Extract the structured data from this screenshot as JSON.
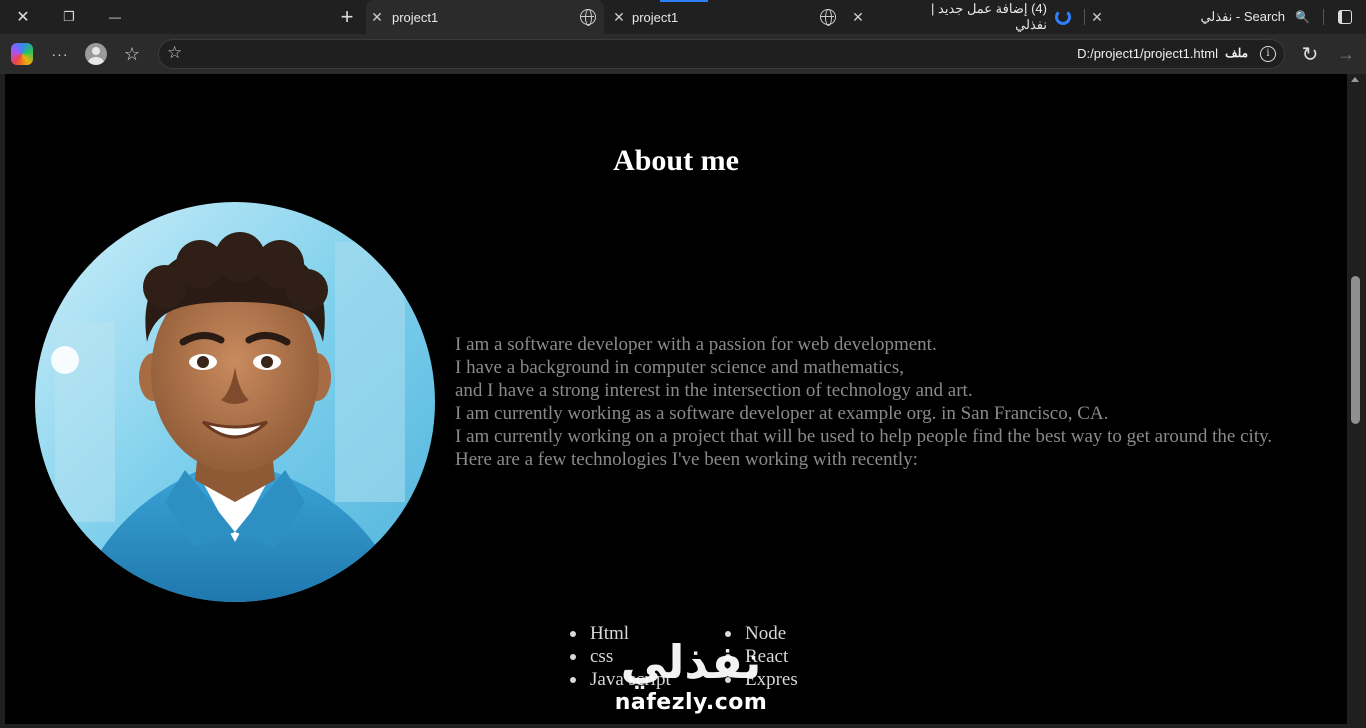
{
  "browser": {
    "tabs": [
      {
        "title": "project1",
        "active": true
      },
      {
        "title": "project1",
        "active": false
      },
      {
        "title": "(4) إضافة عمل جديد | نفذلي",
        "active": false
      },
      {
        "title": "Search - نفذلي",
        "active": false
      }
    ],
    "address": {
      "url": "D:/project1/project1.html",
      "scheme_label": "ملف"
    },
    "icons": {
      "close": "✕",
      "restore": "❐",
      "minimize": "—",
      "new_tab": "+",
      "more": "···",
      "refresh": "↻",
      "forward": "→",
      "favorites_star": "☆",
      "collections": "☆",
      "info": "i"
    }
  },
  "page": {
    "title": "About me",
    "bio_lines": [
      "I am a software developer with a passion for web development.",
      "I have a background in computer science and mathematics,",
      "and I have a strong interest in the intersection of technology and art.",
      "I am currently working as a software developer at example org. in San Francisco, CA.",
      "I am currently working on a project that will be used to help people find the best way to get around the city.",
      "Here are a few technologies I've been working with recently:"
    ],
    "tech_left": [
      "Html",
      "css",
      "Java script"
    ],
    "tech_right": [
      "Node",
      "React",
      "Expres"
    ]
  },
  "watermark": {
    "arabic": "نفذلي",
    "latin": "nafezly.com"
  }
}
